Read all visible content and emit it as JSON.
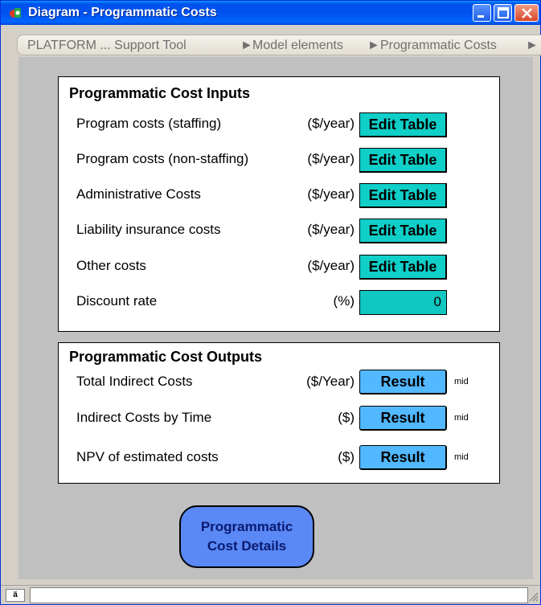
{
  "window": {
    "title": "Diagram - Programmatic Costs",
    "controls": {
      "minimize": "minimize",
      "maximize": "maximize",
      "close": "close"
    }
  },
  "breadcrumb": {
    "items": [
      "PLATFORM ... Support Tool",
      "Model elements",
      "Programmatic Costs"
    ]
  },
  "inputs": {
    "title": "Programmatic Cost Inputs",
    "rows": [
      {
        "label": "Program costs (staffing)",
        "unit": "($/year)",
        "action": "Edit Table"
      },
      {
        "label": "Program costs (non-staffing)",
        "unit": "($/year)",
        "action": "Edit Table"
      },
      {
        "label": "Administrative Costs",
        "unit": "($/year)",
        "action": "Edit Table"
      },
      {
        "label": "Liability insurance costs",
        "unit": "($/year)",
        "action": "Edit Table"
      },
      {
        "label": "Other costs",
        "unit": "($/year)",
        "action": "Edit Table"
      }
    ],
    "discount": {
      "label": "Discount rate",
      "unit": "(%)",
      "value": "0"
    }
  },
  "outputs": {
    "title": "Programmatic Cost Outputs",
    "rows": [
      {
        "label": "Total Indirect Costs",
        "unit": "($/Year)",
        "action": "Result",
        "tag": "mid"
      },
      {
        "label": "Indirect Costs by Time",
        "unit": "($)",
        "action": "Result",
        "tag": "mid"
      },
      {
        "label": "NPV of estimated costs",
        "unit": "($)",
        "action": "Result",
        "tag": "mid"
      }
    ]
  },
  "details_button": {
    "line1": "Programmatic",
    "line2": "Cost Details"
  },
  "statusbar": {
    "indicator": "ä"
  },
  "colors": {
    "titlebar": "#0053ee",
    "edit_button": "#0fcfc8",
    "result_button": "#52b8ff",
    "details_button": "#5a88f5",
    "canvas": "#c0c0c0"
  }
}
